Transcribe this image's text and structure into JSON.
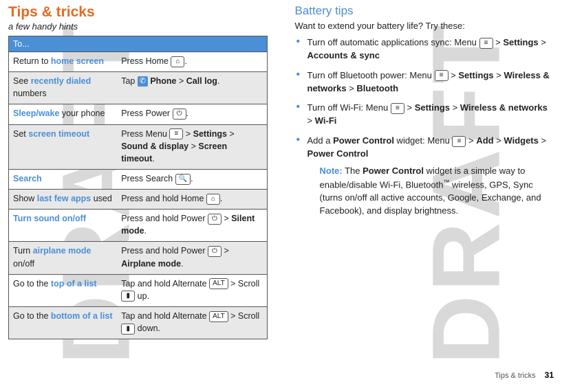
{
  "watermark": "DRAFT",
  "left": {
    "title": "Tips & tricks",
    "subtitle": "a few handy hints",
    "header": "To...",
    "rows": [
      {
        "l1": "Return to ",
        "lhl": "home screen",
        "l2": "",
        "r": "Press Home ",
        "key": "⌂",
        "r2": "."
      },
      {
        "l1": "See ",
        "lhl": "recently dialed",
        "l2": " numbers",
        "r": "Tap ",
        "phone": true,
        "r2a": " Phone",
        "r2b": " > ",
        "r2c": "Call log",
        "r2d": "."
      },
      {
        "lhl": "Sleep/wake",
        "l2": " your phone",
        "r": "Press Power ",
        "key": "⏻",
        "r2": "."
      },
      {
        "l1": "Set ",
        "lhl": "screen timeout",
        "r": "Press Menu ",
        "key": "≡",
        "r2a": " > ",
        "r2b": "Settings",
        "r2c": " > ",
        "r2d": "Sound & display",
        "r2e": " > ",
        "r2f": "Screen timeout",
        "r2g": "."
      },
      {
        "lhl": "Search",
        "r": "Press Search ",
        "key": "🔍",
        "r2": "."
      },
      {
        "l1": "Show ",
        "lhl": "last few apps",
        "l2": " used",
        "r": "Press and hold Home ",
        "key": "⌂",
        "r2": "."
      },
      {
        "lhl": "Turn sound on/off",
        "r": "Press and hold Power ",
        "key": "⏻",
        "r2a": " > ",
        "r2b": "Silent mode",
        "r2c": "."
      },
      {
        "l1": "Turn ",
        "lhl": "airplane mode",
        "l2": " on/off",
        "r": "Press and hold Power ",
        "key": "⏻",
        "r2a": " > ",
        "r2b": "Airplane mode",
        "r2c": "."
      },
      {
        "l1": "Go to the ",
        "lhl": "top of a list",
        "r": "Tap and hold Alternate ",
        "key": "ALT",
        "r2a": " > Scroll ",
        "key2": "▮",
        "r2b": " up."
      },
      {
        "l1": "Go to the ",
        "lhl": "bottom of a list",
        "r": "Tap and hold Alternate ",
        "key": "ALT",
        "r2a": " > Scroll ",
        "key2": "▮",
        "r2b": " down."
      }
    ]
  },
  "right": {
    "title": "Battery tips",
    "intro": "Want to extend your battery life? Try these:",
    "b1a": "Turn off automatic applications sync: Menu ",
    "b1b": " > ",
    "b1c": "Settings",
    "b1d": " > ",
    "b1e": "Accounts & sync",
    "b2a": "Turn off Bluetooth power: Menu ",
    "b2b": " > ",
    "b2c": "Settings",
    "b2d": " > ",
    "b2e": "Wireless & networks",
    "b2f": " > ",
    "b2g": "Bluetooth",
    "b3a": "Turn off Wi-Fi: Menu ",
    "b3b": " > ",
    "b3c": "Settings",
    "b3d": " > ",
    "b3e": "Wireless & networks",
    "b3f": " > ",
    "b3g": "Wi-Fi",
    "b4a": "Add a ",
    "b4b": "Power Control",
    "b4c": " widget: Menu ",
    "b4d": " > ",
    "b4e": "Add",
    "b4f": " > ",
    "b4g": "Widgets",
    "b4h": " > ",
    "b4i": "Power Control",
    "noteLabel": "Note:",
    "note1": " The ",
    "note2": "Power Control",
    "note3": " widget is a simple way to enable/disable Wi-Fi, Bluetooth",
    "tm": "™",
    "note4": " wireless, GPS, Sync (turns on/off all active accounts, Google, Exchange, and Facebook), and display brightness.",
    "menukey": "≡"
  },
  "footer": {
    "section": "Tips & tricks",
    "page": "31"
  }
}
